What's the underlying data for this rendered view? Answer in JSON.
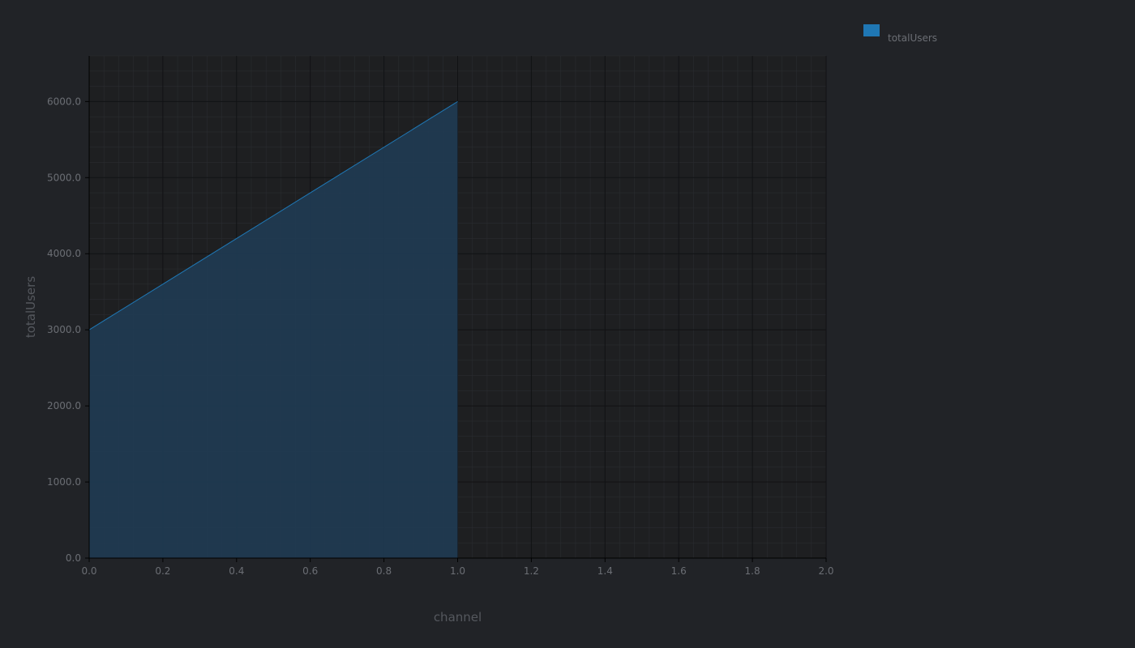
{
  "chart_data": {
    "type": "area",
    "x": [
      0.0,
      1.0
    ],
    "series": [
      {
        "name": "totalUsers",
        "values": [
          3000,
          6000
        ],
        "color": "#1f77b4"
      }
    ],
    "xlabel": "channel",
    "ylabel": "totalUsers",
    "xlim": [
      0.0,
      2.0
    ],
    "ylim": [
      0,
      6600
    ],
    "xticks": [
      "0.0",
      "0.2",
      "0.4",
      "0.6",
      "0.8",
      "1.0",
      "1.2",
      "1.4",
      "1.6",
      "1.8",
      "2.0"
    ],
    "yticks": [
      "0.0",
      "1000.0",
      "2000.0",
      "3000.0",
      "4000.0",
      "5000.0",
      "6000.0"
    ],
    "grid": true,
    "legend_position": "top-right",
    "colors": {
      "background": "#212327",
      "plot_background": "#1e1f21",
      "grid_major": "#111214",
      "grid_minor": "#2a2c30",
      "area_fill": "#1f3b52",
      "area_line": "#1f77b4"
    }
  }
}
